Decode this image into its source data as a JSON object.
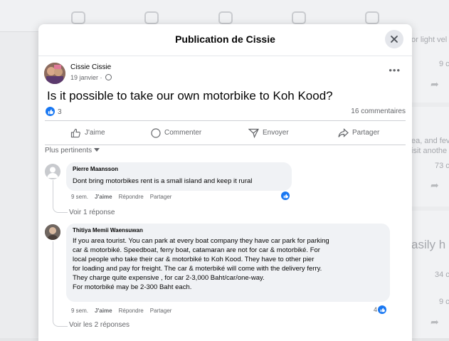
{
  "background": {
    "right_texts": [
      "or light vel",
      "9 c",
      "ea, and fev",
      "isit anothe",
      "73 c",
      "34 c",
      "9 c"
    ],
    "right_big_text": "asily h"
  },
  "modal": {
    "title": "Publication de Cissie",
    "close_icon": "close-icon"
  },
  "post": {
    "author": "Cissie Cissie",
    "date": "19 janvier · ",
    "text": "Is it possible to take our own motorbike to Koh Kood?",
    "reactions_count": "3",
    "comments_count": "16 commentaires"
  },
  "actions": {
    "like": "J'aime",
    "comment": "Commenter",
    "share_send": "Envoyer",
    "share": "Partager"
  },
  "sort": {
    "label": "Plus pertinents"
  },
  "comments": [
    {
      "author": "Pierre Maansson",
      "lines": [
        "Dont bring motorbikes rent is a small island and keep it rural"
      ],
      "time": "9 sem.",
      "like": "J'aime",
      "reply": "Répondre",
      "share": "Partager",
      "reaction_count": "",
      "replies": "Voir 1 réponse"
    },
    {
      "author": "Thitiya Memii Waensuwan",
      "lines": [
        "If you area tourist. You can park at every boat company they have car park for parking",
        "car & motorbiké. Speedboat, ferry boat, catamaran are not for car & motorbiké. For",
        "local people who take their car & motorbiké to Koh Kood. They have to other pier",
        "for loading and pay for freight. The car & moterbiké will come with the delivery ferry.",
        "They charge quite expensive , for car 2-3,000 Baht/car/one-way.",
        "For motorbiké may be 2-300 Baht each."
      ],
      "time": "9 sem.",
      "like": "J'aime",
      "reply": "Répondre",
      "share": "Partager",
      "reaction_count": "4",
      "replies": "Voir les 2 réponses"
    }
  ],
  "colors": {
    "accent": "#1877f2",
    "secondary_text": "#65676b",
    "bubble": "#f0f2f5"
  }
}
